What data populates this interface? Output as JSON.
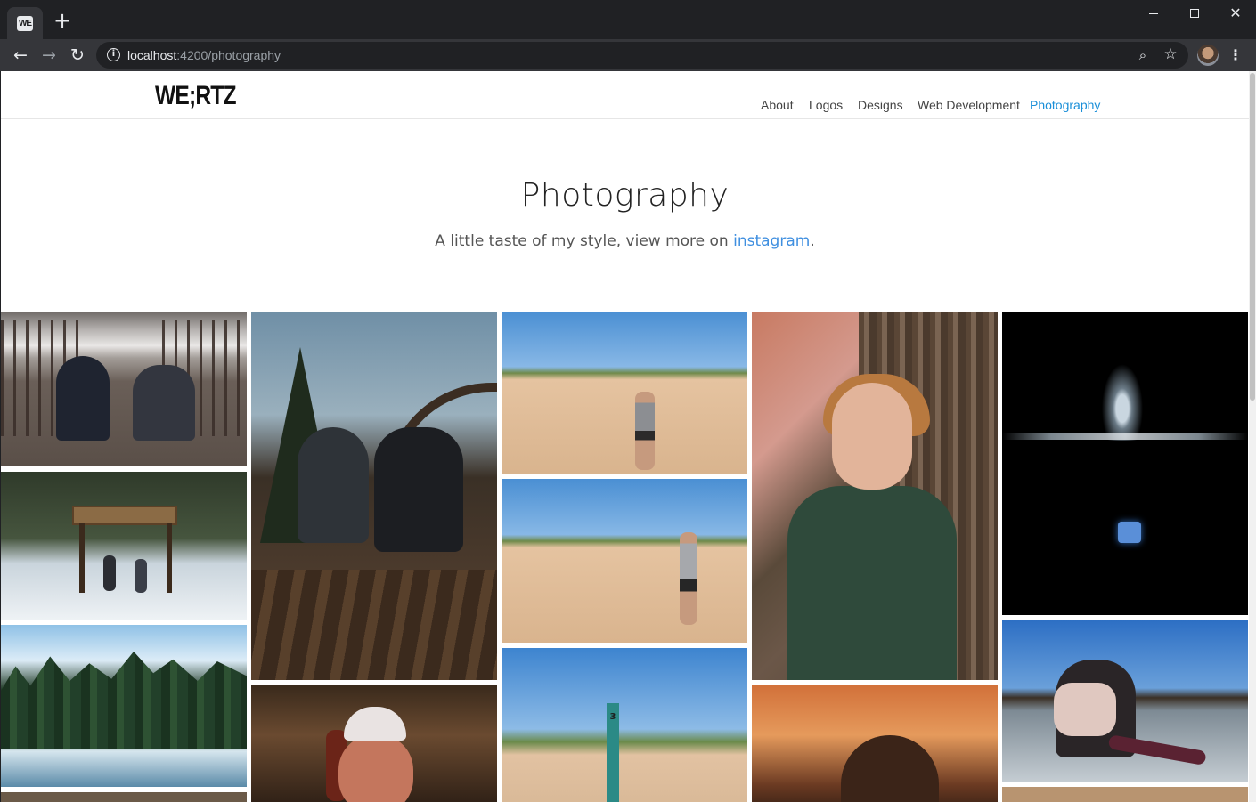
{
  "browser": {
    "tab_favicon_text": "WE",
    "new_tab_label": "+",
    "url_host": "localhost",
    "url_rest": ":4200/photography",
    "icons": {
      "back": "arrow-left-icon",
      "forward": "arrow-right-icon",
      "reload": "reload-icon",
      "info": "info-icon",
      "zoom": "zoom-icon",
      "bookmark": "star-icon",
      "menu": "kebab-menu-icon"
    },
    "window_controls": [
      "minimize",
      "maximize",
      "close"
    ]
  },
  "site": {
    "logo": "WE;RTZ",
    "nav": [
      {
        "label": "About",
        "active": false
      },
      {
        "label": "Logos",
        "active": false
      },
      {
        "label": "Designs",
        "active": false
      },
      {
        "label": "Web Development",
        "active": false
      },
      {
        "label": "Photography",
        "active": true
      }
    ],
    "accent_color": "#1a8fd8"
  },
  "hero": {
    "title": "Photography",
    "subtitle_prefix": "A little taste of my style, view more on ",
    "subtitle_link": "instagram",
    "subtitle_suffix": "."
  },
  "gallery": {
    "photos": [
      {
        "subject": "two people crouching on bridge"
      },
      {
        "subject": "snowy trail sign with hikers"
      },
      {
        "subject": "frozen waterfall and pine forest"
      },
      {
        "subject": "two girls posing on bridge"
      },
      {
        "subject": "girl in white cap"
      },
      {
        "subject": "man standing on sand dune"
      },
      {
        "subject": "man walking on sand dune"
      },
      {
        "subject": "dune trail marker post"
      },
      {
        "subject": "girl in green sweater by tree"
      },
      {
        "subject": "autumn leaves portrait"
      },
      {
        "subject": "water splash on black background"
      },
      {
        "subject": "girl stretching by frozen lake"
      }
    ],
    "trail_post_number": "3"
  }
}
